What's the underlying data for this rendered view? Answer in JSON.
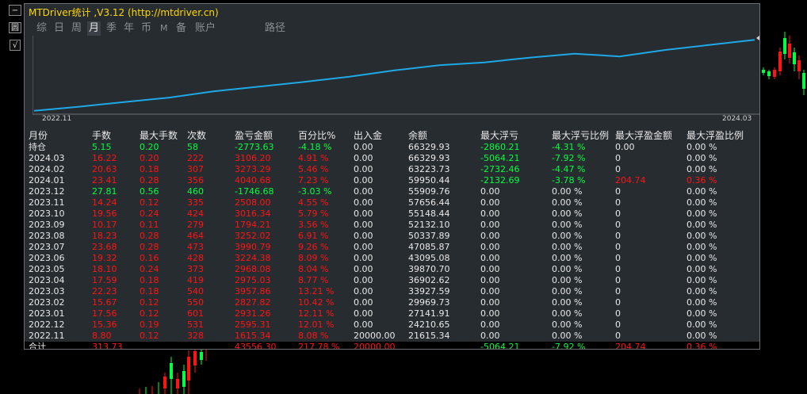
{
  "side_buttons": [
    "−",
    "圆",
    "√"
  ],
  "title": "MTDriver统计 ,V3.12 (http://mtdriver.cn)",
  "tabs": [
    {
      "label": "综",
      "active": false
    },
    {
      "label": "日",
      "active": false
    },
    {
      "label": "周",
      "active": false
    },
    {
      "label": "月",
      "active": true
    },
    {
      "label": "季",
      "active": false
    },
    {
      "label": "年",
      "active": false
    },
    {
      "label": "币",
      "active": false
    },
    {
      "label": "M",
      "active": false
    },
    {
      "label": "备",
      "active": false
    },
    {
      "label": "账户",
      "active": false
    },
    {
      "label": "路径",
      "active": false
    }
  ],
  "chart_data": {
    "type": "line",
    "x": [
      "2022.11",
      "2022.12",
      "2023.01",
      "2023.02",
      "2023.03",
      "2023.04",
      "2023.05",
      "2023.06",
      "2023.07",
      "2023.08",
      "2023.09",
      "2023.10",
      "2023.11",
      "2023.12",
      "2024.01",
      "2024.02",
      "2024.03"
    ],
    "values": [
      21615.34,
      24210.65,
      27141.91,
      29969.73,
      33927.59,
      36902.62,
      39870.7,
      43095.08,
      47085.87,
      50337.89,
      52132.1,
      55148.44,
      57656.44,
      55909.76,
      59950.44,
      63223.73,
      66329.93
    ],
    "xlabel_start": "2022.11",
    "xlabel_end": "2024.03",
    "color": "#1ea8e6"
  },
  "table": {
    "headers": [
      "月份",
      "手数",
      "最大手数",
      "次数",
      "盈亏金额",
      "百分比%",
      "出入金",
      "余额",
      "最大浮亏",
      "最大浮亏比例",
      "最大浮盈金额",
      "最大浮盈比例"
    ],
    "rows": [
      {
        "color": "g",
        "cells": [
          "持仓",
          "5.15",
          "0.20",
          "58",
          "-2773.63",
          "-4.18 %",
          "0.00",
          "66329.93",
          "-2860.21",
          "-4.31 %",
          "0.00",
          "0.00 %"
        ]
      },
      {
        "color": "r",
        "cells": [
          "2024.03",
          "16.22",
          "0.20",
          "222",
          "3106.20",
          "4.91 %",
          "0.00",
          "66329.93",
          "-5064.21",
          "-7.92 %",
          "0",
          "0.00 %"
        ]
      },
      {
        "color": "r",
        "cells": [
          "2024.02",
          "20.63",
          "0.18",
          "307",
          "3273.29",
          "5.46 %",
          "0.00",
          "63223.73",
          "-2732.46",
          "-4.47 %",
          "0",
          "0.00 %"
        ]
      },
      {
        "color": "r",
        "cells": [
          "2024.01",
          "23.41",
          "0.28",
          "356",
          "4040.68",
          "7.23 %",
          "0.00",
          "59950.44",
          "-2132.69",
          "-3.78 %",
          "204.74",
          "0.36 %"
        ]
      },
      {
        "color": "g",
        "cells": [
          "2023.12",
          "27.81",
          "0.56",
          "460",
          "-1746.68",
          "-3.03 %",
          "0.00",
          "55909.76",
          "0.00",
          "0.00 %",
          "0",
          "0.00 %"
        ]
      },
      {
        "color": "r",
        "cells": [
          "2023.11",
          "14.24",
          "0.12",
          "335",
          "2508.00",
          "4.55 %",
          "0.00",
          "57656.44",
          "0.00",
          "0.00 %",
          "0",
          "0.00 %"
        ]
      },
      {
        "color": "r",
        "cells": [
          "2023.10",
          "19.56",
          "0.24",
          "424",
          "3016.34",
          "5.79 %",
          "0.00",
          "55148.44",
          "0.00",
          "0.00 %",
          "0",
          "0.00 %"
        ]
      },
      {
        "color": "r",
        "cells": [
          "2023.09",
          "10.17",
          "0.11",
          "279",
          "1794.21",
          "3.56 %",
          "0.00",
          "52132.10",
          "0.00",
          "0.00 %",
          "0",
          "0.00 %"
        ]
      },
      {
        "color": "r",
        "cells": [
          "2023.08",
          "18.23",
          "0.28",
          "464",
          "3252.02",
          "6.91 %",
          "0.00",
          "50337.89",
          "0.00",
          "0.00 %",
          "0",
          "0.00 %"
        ]
      },
      {
        "color": "r",
        "cells": [
          "2023.07",
          "23.68",
          "0.28",
          "473",
          "3990.79",
          "9.26 %",
          "0.00",
          "47085.87",
          "0.00",
          "0.00 %",
          "0",
          "0.00 %"
        ]
      },
      {
        "color": "r",
        "cells": [
          "2023.06",
          "19.32",
          "0.16",
          "428",
          "3224.38",
          "8.09 %",
          "0.00",
          "43095.08",
          "0.00",
          "0.00 %",
          "0",
          "0.00 %"
        ]
      },
      {
        "color": "r",
        "cells": [
          "2023.05",
          "18.10",
          "0.24",
          "373",
          "2968.08",
          "8.04 %",
          "0.00",
          "39870.70",
          "0.00",
          "0.00 %",
          "0",
          "0.00 %"
        ]
      },
      {
        "color": "r",
        "cells": [
          "2023.04",
          "17.59",
          "0.18",
          "419",
          "2975.03",
          "8.77 %",
          "0.00",
          "36902.62",
          "0.00",
          "0.00 %",
          "0",
          "0.00 %"
        ]
      },
      {
        "color": "r",
        "cells": [
          "2023.03",
          "22.23",
          "0.18",
          "540",
          "3957.86",
          "13.21 %",
          "0.00",
          "33927.59",
          "0.00",
          "0.00 %",
          "0",
          "0.00 %"
        ]
      },
      {
        "color": "r",
        "cells": [
          "2023.02",
          "15.67",
          "0.12",
          "550",
          "2827.82",
          "10.42 %",
          "0.00",
          "29969.73",
          "0.00",
          "0.00 %",
          "0",
          "0.00 %"
        ]
      },
      {
        "color": "r",
        "cells": [
          "2023.01",
          "17.56",
          "0.12",
          "601",
          "2931.26",
          "12.11 %",
          "0.00",
          "27141.91",
          "0.00",
          "0.00 %",
          "0",
          "0.00 %"
        ]
      },
      {
        "color": "r",
        "cells": [
          "2022.12",
          "15.36",
          "0.19",
          "531",
          "2595.31",
          "12.01 %",
          "0.00",
          "24210.65",
          "0.00",
          "0.00 %",
          "0",
          "0.00 %"
        ]
      },
      {
        "color": "r",
        "cells": [
          "2022.11",
          "8.80",
          "0.12",
          "328",
          "1615.34",
          "8.08 %",
          "20000.00",
          "21615.34",
          "0.00",
          "0.00 %",
          "0",
          "0.00 %"
        ]
      }
    ],
    "total": [
      "合计",
      "313.73",
      "",
      "",
      "43556.30",
      "217.78 %",
      "20000.00",
      "",
      "-5064.21",
      "-7.92 %",
      "204.74",
      "0.36 %"
    ]
  }
}
